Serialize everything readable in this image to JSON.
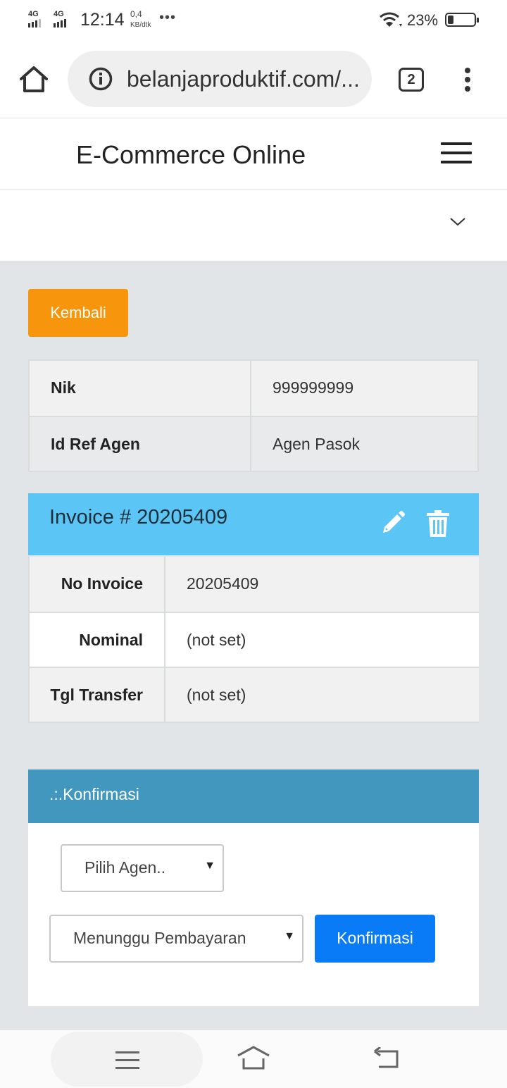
{
  "status_bar": {
    "network_1": "4G",
    "network_2": "4G",
    "time": "12:14",
    "speed_value": "0,4",
    "speed_unit": "KB/dtk",
    "battery": "23%"
  },
  "browser": {
    "url": "belanjaproduktif.com/...",
    "tab_count": "2"
  },
  "site": {
    "brand": "E-Commerce Online"
  },
  "content": {
    "back_button": "Kembali",
    "profile": [
      {
        "label": "Nik",
        "value": "999999999"
      },
      {
        "label": "Id Ref Agen",
        "value": "Agen Pasok"
      }
    ],
    "invoice": {
      "title": "Invoice # 20205409",
      "rows": [
        {
          "label": "No Invoice",
          "value": "20205409"
        },
        {
          "label": "Nominal",
          "value": "(not set)"
        },
        {
          "label": "Tgl Transfer",
          "value": "(not set)"
        }
      ]
    },
    "konfirmasi": {
      "title": ".:.Konfirmasi",
      "agent_select": "Pilih Agen..",
      "status_select": "Menunggu Pembayaran",
      "submit": "Konfirmasi"
    }
  },
  "colors": {
    "back_button": "#f7950d",
    "invoice_header": "#5bc6f5",
    "konfirmasi_header": "#4297bf",
    "submit_button": "#0a7bf6"
  }
}
